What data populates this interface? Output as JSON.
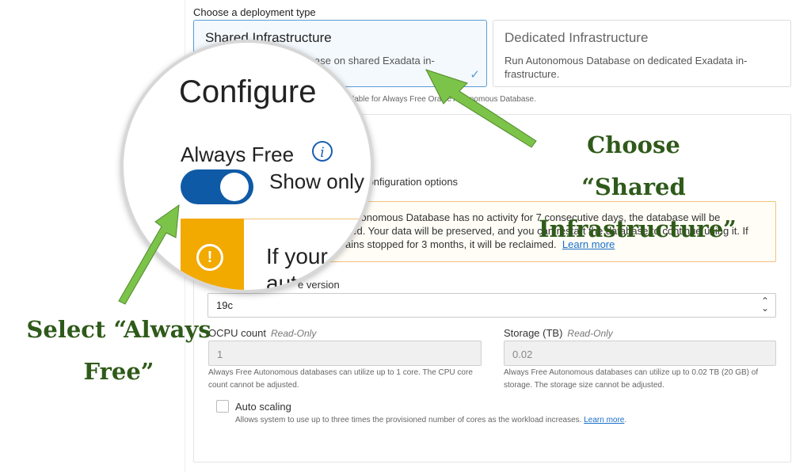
{
  "deployment": {
    "heading": "Choose a deployment type",
    "shared": {
      "title": "Shared Infrastructure",
      "desc": "Run Autonomous Database on shared Exadata in-\nfrastructure."
    },
    "dedicated": {
      "title": "Dedicated Infrastructure",
      "desc": "Run Autonomous Database on dedicated Exadata in-\nfrastructure."
    },
    "note": "is not available for Always Free Oracle Autonomous Database."
  },
  "config": {
    "title_tail": "base",
    "toggle_tail": "ee configuration options",
    "warning_lines": [
      "Autonomous Database has no activity for 7 consecutive days, the database will be",
      "ped. Your data will be preserved, and you can restart the database to continue using it. If",
      "ains stopped for 3 months, it will be reclaimed."
    ],
    "learn_more": "Learn more",
    "version_label": "e version",
    "version_value": "19c",
    "ocpu_label": "OCPU count",
    "ocpu_readonly": "Read-Only",
    "ocpu_value": "1",
    "ocpu_help": "Always Free Autonomous databases can utilize up to 1 core. The CPU core count cannot be adjusted.",
    "storage_label": "Storage (TB)",
    "storage_readonly": "Read-Only",
    "storage_value": "0.02",
    "storage_help": "Always Free Autonomous databases can utilize up to 0.02 TB (20 GB) of storage. The storage size cannot be adjusted.",
    "auto_scaling_label": "Auto scaling",
    "auto_scaling_help": "Allows system to use up to three times the provisioned number of cores as the workload increases.",
    "auto_scaling_link": "Learn more",
    "auto_scaling_checked": false
  },
  "magnifier": {
    "title": "Configure",
    "always_free": "Always Free",
    "show_only": "Show only",
    "if_your": "If your",
    "auto": "aut"
  },
  "annotations": {
    "choose": "Choose “Shared\nInfrastructure”",
    "select": "Select “Always\nFree”"
  },
  "colors": {
    "arrow": "#7cc34a",
    "toggle": "#0f5aa6",
    "warning": "#f2a900",
    "selected_border": "#5b9bd5"
  }
}
